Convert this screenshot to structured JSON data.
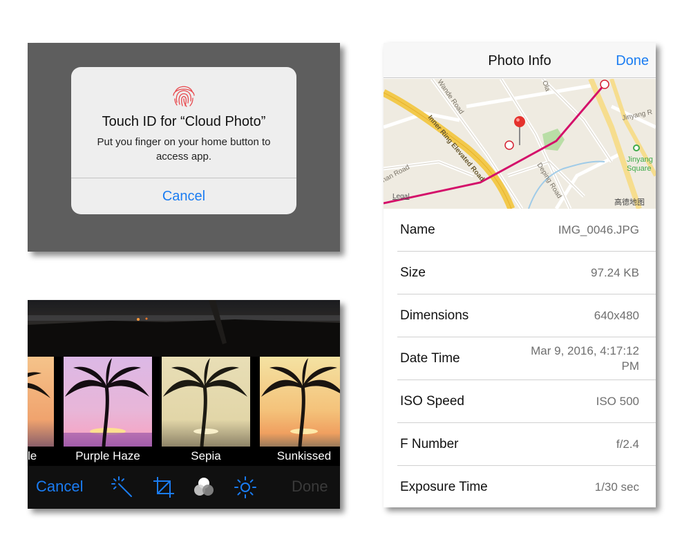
{
  "touchid": {
    "title": "Touch ID for “Cloud Photo”",
    "message": "Put you finger on your home button to access app.",
    "cancel_label": "Cancel",
    "icon": "fingerprint-icon",
    "accent": "#1a7cf2"
  },
  "filters": {
    "items": [
      {
        "label": "le",
        "icon": "palm-tree-icon"
      },
      {
        "label": "Purple Haze",
        "icon": "palm-tree-icon"
      },
      {
        "label": "Sepia",
        "icon": "palm-tree-icon"
      },
      {
        "label": "Sunkissed",
        "icon": "palm-tree-icon"
      }
    ],
    "toolbar": {
      "cancel_label": "Cancel",
      "done_label": "Done",
      "icons": [
        "magic-wand-icon",
        "crop-icon",
        "filters-icon",
        "brightness-icon"
      ]
    }
  },
  "info": {
    "title": "Photo Info",
    "done_label": "Done",
    "map": {
      "labels": {
        "wande": "Wande Road",
        "ola": "Ola",
        "inner_ring": "Inner Ring Elevated Road",
        "jinyang_rd": "Jinyang R",
        "jinyang_sq_1": "Jinyang",
        "jinyang_sq_2": "Square",
        "deping": "Deping Road",
        "nan": "nan Road",
        "legal": "Legal",
        "provider": "高德地图"
      }
    },
    "rows": [
      {
        "name": "Name",
        "value": "IMG_0046.JPG"
      },
      {
        "name": "Size",
        "value": "97.24 KB"
      },
      {
        "name": "Dimensions",
        "value": "640x480"
      },
      {
        "name": "Date Time",
        "value": "Mar 9, 2016, 4:17:12 PM"
      },
      {
        "name": "ISO Speed",
        "value": "ISO 500"
      },
      {
        "name": "F Number",
        "value": "f/2.4"
      },
      {
        "name": "Exposure Time",
        "value": "1/30 sec"
      }
    ]
  }
}
